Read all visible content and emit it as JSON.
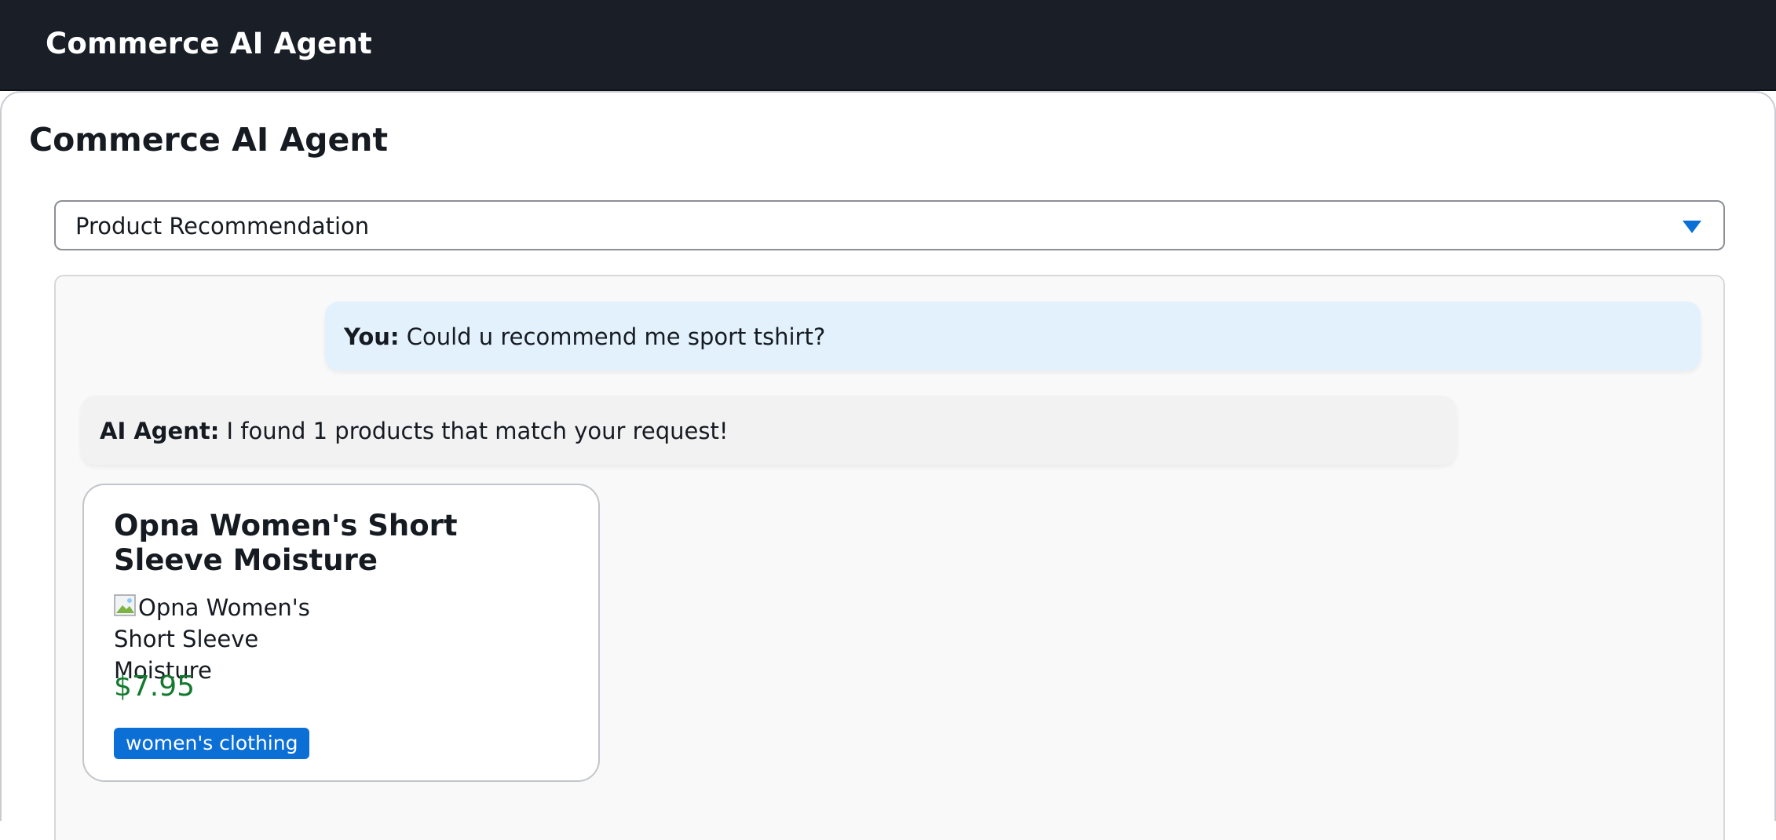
{
  "header": {
    "app_title": "Commerce AI Agent"
  },
  "main": {
    "page_title": "Commerce AI Agent",
    "mode_select": {
      "selected": "Product Recommendation",
      "icon": "triangle-down-icon"
    },
    "chat": {
      "messages": [
        {
          "speaker": "You:",
          "text": " Could u recommend me sport tshirt?"
        },
        {
          "speaker": "AI Agent:",
          "text": " I found 1 products that match your request!"
        }
      ],
      "products": [
        {
          "name": "Opna Women's Short Sleeve Moisture",
          "image_alt": "Opna Women's Short Sleeve Moisture",
          "price": "$7.95",
          "category": "women's clothing"
        }
      ]
    }
  },
  "colors": {
    "topbar_bg": "#1a1f27",
    "accent_blue": "#0c6fd6",
    "price_green": "#137a2e",
    "user_bubble": "#e3f1fd",
    "agent_bubble": "#f2f2f2"
  }
}
